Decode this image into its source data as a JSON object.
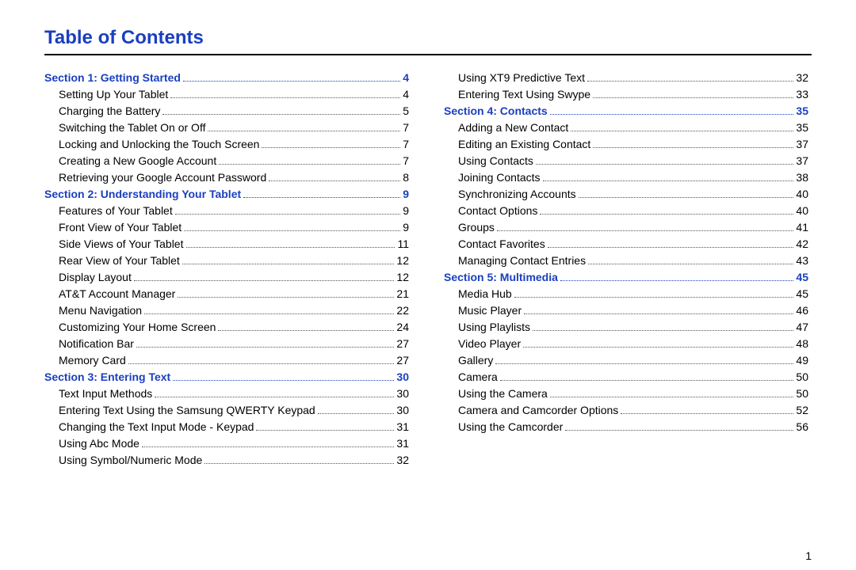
{
  "title": "Table of Contents",
  "page_number": "1",
  "chart_data": {
    "type": "table",
    "title": "Table of Contents",
    "columns": [
      "level",
      "title",
      "page"
    ],
    "rows": [
      [
        "section",
        "Section 1:  Getting Started",
        4
      ],
      [
        "sub",
        "Setting Up Your Tablet",
        4
      ],
      [
        "sub",
        "Charging the Battery",
        5
      ],
      [
        "sub",
        "Switching the Tablet On or Off",
        7
      ],
      [
        "sub",
        "Locking and Unlocking the Touch Screen",
        7
      ],
      [
        "sub",
        "Creating a New Google Account",
        7
      ],
      [
        "sub",
        "Retrieving your Google Account Password",
        8
      ],
      [
        "section",
        "Section 2:  Understanding Your Tablet",
        9
      ],
      [
        "sub",
        "Features of Your Tablet",
        9
      ],
      [
        "sub",
        "Front View of Your Tablet",
        9
      ],
      [
        "sub",
        "Side Views of Your Tablet",
        11
      ],
      [
        "sub",
        "Rear View of Your Tablet",
        12
      ],
      [
        "sub",
        "Display Layout",
        12
      ],
      [
        "sub",
        "AT&T Account Manager",
        21
      ],
      [
        "sub",
        "Menu Navigation",
        22
      ],
      [
        "sub",
        "Customizing Your Home Screen",
        24
      ],
      [
        "sub",
        "Notification Bar",
        27
      ],
      [
        "sub",
        "Memory Card",
        27
      ],
      [
        "section",
        "Section 3:  Entering Text",
        30
      ],
      [
        "sub",
        "Text Input Methods",
        30
      ],
      [
        "sub",
        "Entering Text Using the Samsung QWERTY Keypad",
        30
      ],
      [
        "sub",
        "Changing the Text Input Mode - Keypad",
        31
      ],
      [
        "sub",
        "Using Abc Mode",
        31
      ],
      [
        "sub",
        "Using Symbol/Numeric Mode",
        32
      ],
      [
        "sub",
        "Using XT9 Predictive Text",
        32
      ],
      [
        "sub",
        "Entering Text Using Swype",
        33
      ],
      [
        "section",
        "Section 4:  Contacts",
        35
      ],
      [
        "sub",
        "Adding a New Contact",
        35
      ],
      [
        "sub",
        "Editing an Existing Contact",
        37
      ],
      [
        "sub",
        "Using Contacts",
        37
      ],
      [
        "sub",
        "Joining Contacts",
        38
      ],
      [
        "sub",
        "Synchronizing Accounts",
        40
      ],
      [
        "sub",
        "Contact Options",
        40
      ],
      [
        "sub",
        "Groups",
        41
      ],
      [
        "sub",
        "Contact Favorites",
        42
      ],
      [
        "sub",
        "Managing Contact Entries",
        43
      ],
      [
        "section",
        "Section 5:  Multimedia",
        45
      ],
      [
        "sub",
        "Media Hub",
        45
      ],
      [
        "sub",
        "Music Player",
        46
      ],
      [
        "sub",
        "Using Playlists",
        47
      ],
      [
        "sub",
        "Video Player",
        48
      ],
      [
        "sub",
        "Gallery",
        49
      ],
      [
        "sub",
        "Camera",
        50
      ],
      [
        "sub",
        "Using the Camera",
        50
      ],
      [
        "sub",
        "Camera and Camcorder Options",
        52
      ],
      [
        "sub",
        "Using the Camcorder",
        56
      ]
    ]
  },
  "left": [
    {
      "t": "sec",
      "title": "Section 1:  Getting Started",
      "page": "4"
    },
    {
      "t": "sub",
      "title": "Setting Up Your Tablet",
      "page": "4"
    },
    {
      "t": "sub",
      "title": "Charging the Battery",
      "page": "5"
    },
    {
      "t": "sub",
      "title": "Switching the Tablet On or Off",
      "page": "7"
    },
    {
      "t": "sub",
      "title": "Locking and Unlocking the Touch Screen",
      "page": "7"
    },
    {
      "t": "sub",
      "title": "Creating a New Google Account",
      "page": "7"
    },
    {
      "t": "sub",
      "title": "Retrieving your Google Account Password",
      "page": "8"
    },
    {
      "t": "sec",
      "title": "Section 2:  Understanding Your Tablet",
      "page": "9"
    },
    {
      "t": "sub",
      "title": "Features of Your Tablet",
      "page": "9"
    },
    {
      "t": "sub",
      "title": "Front View of Your Tablet",
      "page": "9"
    },
    {
      "t": "sub",
      "title": "Side Views of Your Tablet",
      "page": "11"
    },
    {
      "t": "sub",
      "title": "Rear View of Your Tablet",
      "page": "12"
    },
    {
      "t": "sub",
      "title": "Display Layout",
      "page": "12"
    },
    {
      "t": "sub",
      "title": "AT&T Account Manager",
      "page": "21"
    },
    {
      "t": "sub",
      "title": "Menu Navigation",
      "page": "22"
    },
    {
      "t": "sub",
      "title": "Customizing Your Home Screen",
      "page": "24"
    },
    {
      "t": "sub",
      "title": "Notification Bar",
      "page": "27"
    },
    {
      "t": "sub",
      "title": "Memory Card",
      "page": "27"
    },
    {
      "t": "sec",
      "title": "Section 3:  Entering Text",
      "page": "30"
    },
    {
      "t": "sub",
      "title": "Text Input Methods",
      "page": "30"
    },
    {
      "t": "sub",
      "title": "Entering Text Using the Samsung QWERTY Keypad",
      "page": "30"
    },
    {
      "t": "sub",
      "title": "Changing the Text Input Mode - Keypad",
      "page": "31"
    },
    {
      "t": "sub",
      "title": "Using Abc Mode",
      "page": "31"
    },
    {
      "t": "sub",
      "title": "Using Symbol/Numeric Mode",
      "page": "32"
    }
  ],
  "right": [
    {
      "t": "sub",
      "title": "Using XT9 Predictive Text",
      "page": "32"
    },
    {
      "t": "sub",
      "title": "Entering Text Using Swype",
      "page": "33"
    },
    {
      "t": "sec",
      "title": "Section 4:  Contacts",
      "page": "35"
    },
    {
      "t": "sub",
      "title": "Adding a New Contact",
      "page": "35"
    },
    {
      "t": "sub",
      "title": "Editing an Existing Contact",
      "page": "37"
    },
    {
      "t": "sub",
      "title": "Using Contacts",
      "page": "37"
    },
    {
      "t": "sub",
      "title": "Joining Contacts",
      "page": "38"
    },
    {
      "t": "sub",
      "title": "Synchronizing Accounts",
      "page": "40"
    },
    {
      "t": "sub",
      "title": "Contact Options",
      "page": "40"
    },
    {
      "t": "sub",
      "title": "Groups",
      "page": "41"
    },
    {
      "t": "sub",
      "title": "Contact Favorites",
      "page": "42"
    },
    {
      "t": "sub",
      "title": "Managing Contact Entries",
      "page": "43"
    },
    {
      "t": "sec",
      "title": "Section 5:  Multimedia",
      "page": "45"
    },
    {
      "t": "sub",
      "title": "Media Hub",
      "page": "45"
    },
    {
      "t": "sub",
      "title": "Music Player",
      "page": "46"
    },
    {
      "t": "sub",
      "title": "Using Playlists",
      "page": "47"
    },
    {
      "t": "sub",
      "title": "Video Player",
      "page": "48"
    },
    {
      "t": "sub",
      "title": "Gallery",
      "page": "49"
    },
    {
      "t": "sub",
      "title": "Camera",
      "page": "50"
    },
    {
      "t": "sub",
      "title": "Using the Camera",
      "page": "50"
    },
    {
      "t": "sub",
      "title": "Camera and Camcorder Options",
      "page": "52"
    },
    {
      "t": "sub",
      "title": "Using the Camcorder",
      "page": "56"
    }
  ]
}
